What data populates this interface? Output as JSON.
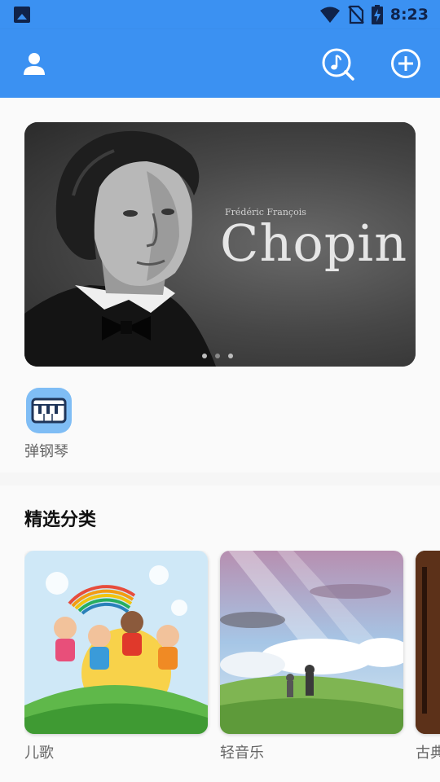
{
  "status_bar": {
    "time": "8:23",
    "icons": [
      "image-icon",
      "wifi-icon",
      "no-sim-icon",
      "battery-charging-icon"
    ]
  },
  "app_bar": {
    "icons": [
      "user-icon",
      "music-search-icon",
      "add-circle-icon"
    ]
  },
  "banner": {
    "subtitle": "Frédéric François",
    "title": "Chopin",
    "page_indicator": {
      "count": 3,
      "active_index": 1
    }
  },
  "quick_actions": [
    {
      "label": "弹钢琴",
      "icon": "piano-icon"
    }
  ],
  "featured": {
    "title": "精选分类",
    "categories": [
      {
        "label": "儿歌"
      },
      {
        "label": "轻音乐"
      },
      {
        "label": "古典"
      }
    ]
  },
  "colors": {
    "primary": "#3b91f2",
    "status_icon": "#10234a",
    "piano_icon_bg": "#7fbdf5"
  }
}
